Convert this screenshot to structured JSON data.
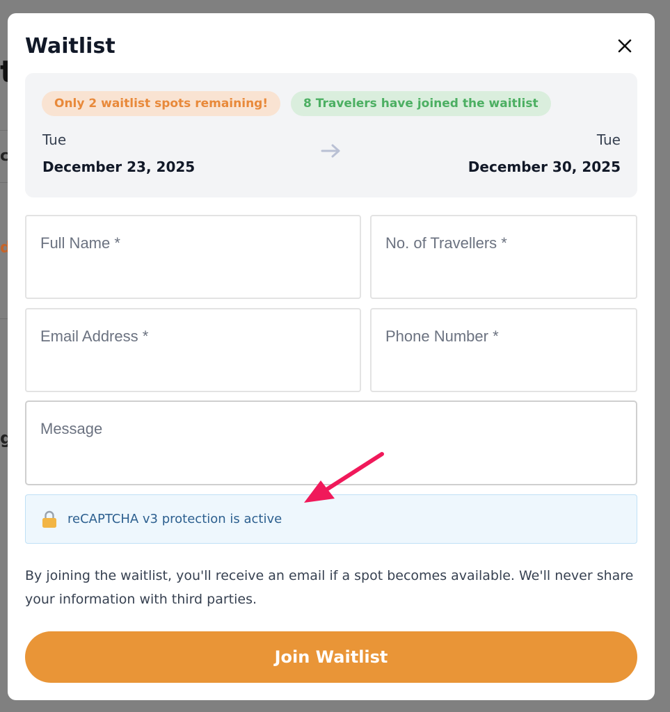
{
  "modal": {
    "title": "Waitlist",
    "close_icon": "close-icon"
  },
  "info": {
    "badge_remaining": "Only 2 waitlist spots remaining!",
    "badge_joined": "8 Travelers have joined the waitlist",
    "start": {
      "day": "Tue",
      "date": "December 23, 2025"
    },
    "end": {
      "day": "Tue",
      "date": "December 30, 2025"
    },
    "arrow_icon": "arrow-right-icon"
  },
  "form": {
    "full_name_placeholder": "Full Name *",
    "travellers_placeholder": "No. of Travellers *",
    "email_placeholder": "Email Address *",
    "phone_placeholder": "Phone Number *",
    "message_placeholder": "Message"
  },
  "recaptcha": {
    "icon": "lock-icon",
    "text": "reCAPTCHA v3 protection is active"
  },
  "note": "By joining the waitlist, you'll receive an email if a spot becomes available. We'll never share your information with third parties.",
  "submit_label": "Join Waitlist",
  "colors": {
    "accent": "#e99537",
    "badge_orange_text": "#e8893a",
    "badge_green_text": "#4caf62",
    "annotation_arrow": "#f0195a"
  }
}
